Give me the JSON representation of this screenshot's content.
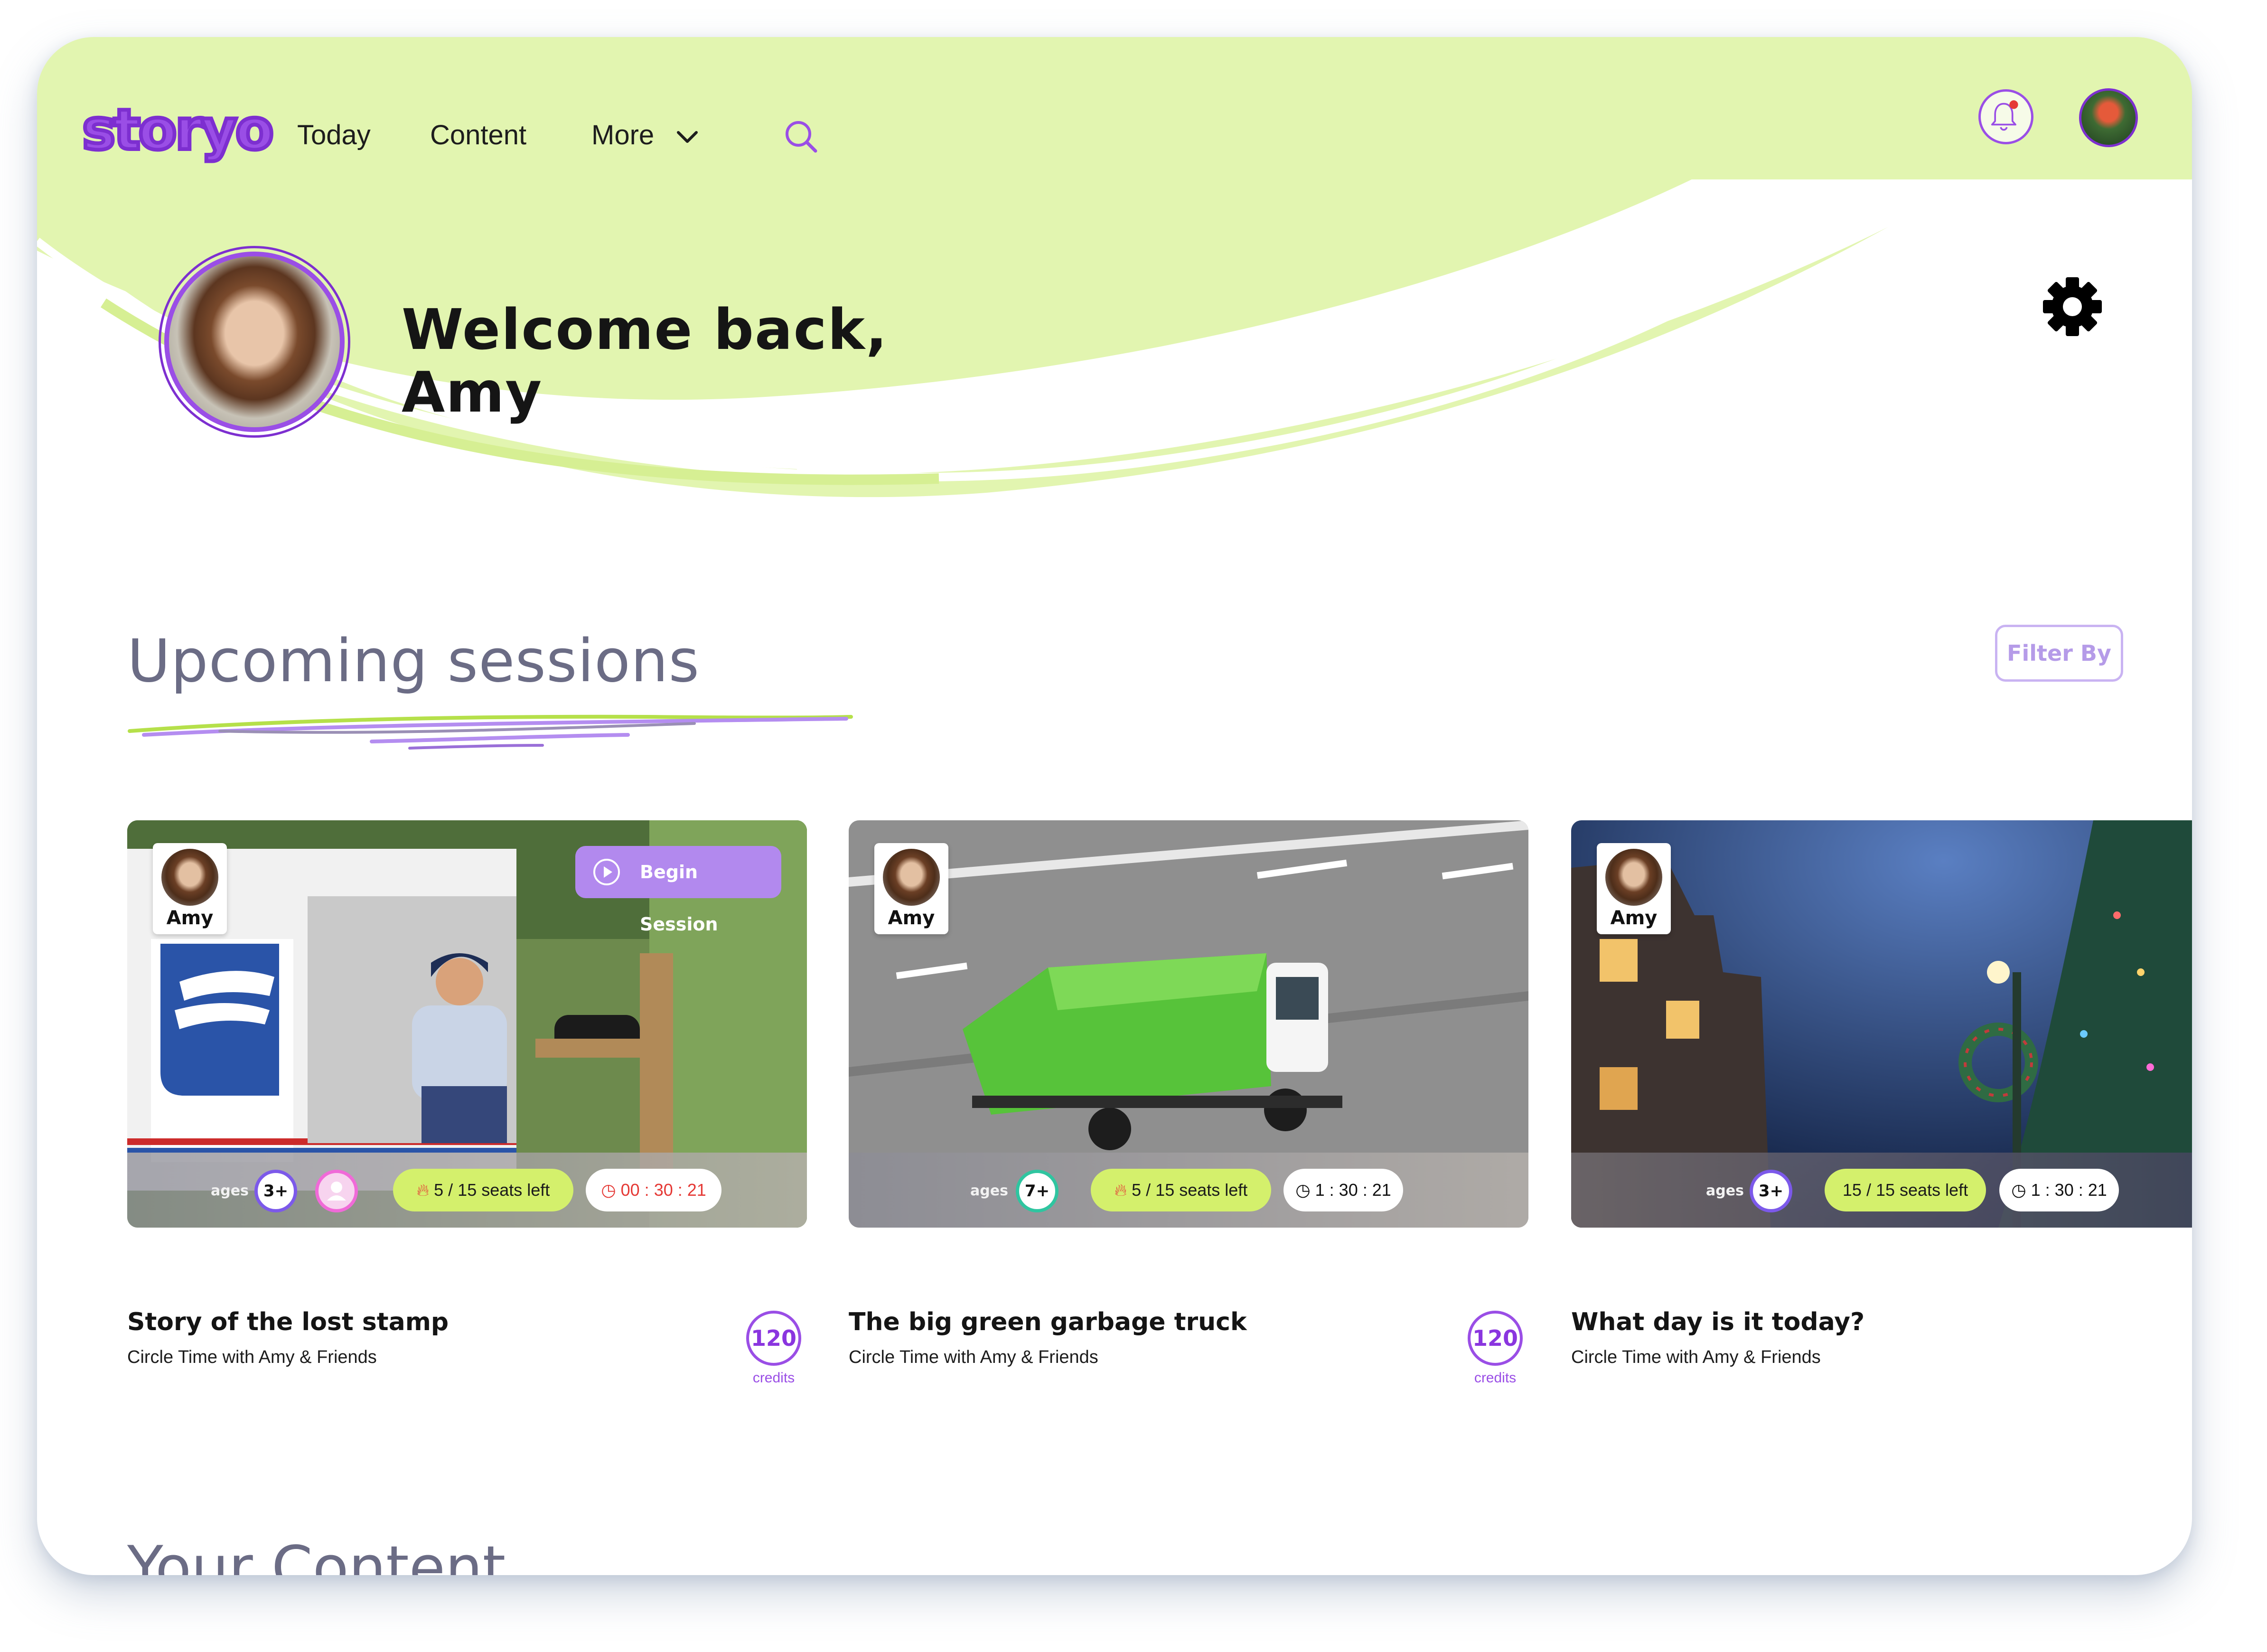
{
  "app": {
    "logo_text": "storyo",
    "brand_color": "#9a4ee6",
    "accent_green": "#e2f5b0"
  },
  "nav": {
    "items": [
      {
        "label": "Today"
      },
      {
        "label": "Content"
      },
      {
        "label": "More"
      }
    ],
    "search_icon": "search-icon",
    "notification_icon": "bell-icon"
  },
  "profile": {
    "welcome_line1": "Welcome back,",
    "welcome_line2": "Amy",
    "settings_icon": "gear-icon"
  },
  "upcoming": {
    "title": "Upcoming sessions",
    "filter_label": "Filter By",
    "sessions": [
      {
        "host": "Amy",
        "begin_label": "Begin Session",
        "ages_label": "ages",
        "age": "3+",
        "seats": "5 / 15 seats left",
        "timer": "00 : 30 : 21",
        "title": "Story of the lost stamp",
        "subtitle": "Circle Time with Amy & Friends",
        "credits": "120",
        "credits_label": "credits"
      },
      {
        "host": "Amy",
        "ages_label": "ages",
        "age": "7+",
        "seats": "5 / 15 seats left",
        "timer": "1 : 30 : 21",
        "title": "The big green garbage truck",
        "subtitle": "Circle Time with Amy & Friends",
        "credits": "120",
        "credits_label": "credits"
      },
      {
        "host": "Amy",
        "ages_label": "ages",
        "age": "3+",
        "seats": "15 / 15 seats left",
        "timer": "1 : 30 : 21",
        "title": "What day is it today?",
        "subtitle": "Circle Time with Amy & Friends"
      }
    ]
  },
  "your_content": {
    "title": "Your Content"
  }
}
